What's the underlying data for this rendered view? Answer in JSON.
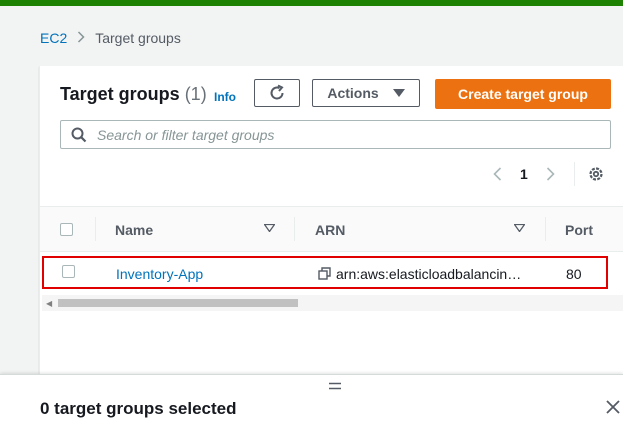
{
  "breadcrumb": {
    "root": "EC2",
    "separator": ">",
    "current": "Target groups"
  },
  "panel": {
    "title": "Target groups",
    "count": "(1)",
    "info": "Info",
    "actions_label": "Actions",
    "create_label": "Create target group",
    "search_placeholder": "Search or filter target groups",
    "page_number": "1"
  },
  "table": {
    "columns": [
      "Name",
      "ARN",
      "Port"
    ],
    "rows": [
      {
        "name": "Inventory-App",
        "arn": "arn:aws:elasticloadbalancin…",
        "port": "80"
      }
    ]
  },
  "split_panel": {
    "selected_text": "0 target groups selected"
  },
  "colors": {
    "primary": "#ec7211",
    "link": "#0073bb",
    "highlight": "#e00000",
    "topbar": "#1d8102"
  }
}
